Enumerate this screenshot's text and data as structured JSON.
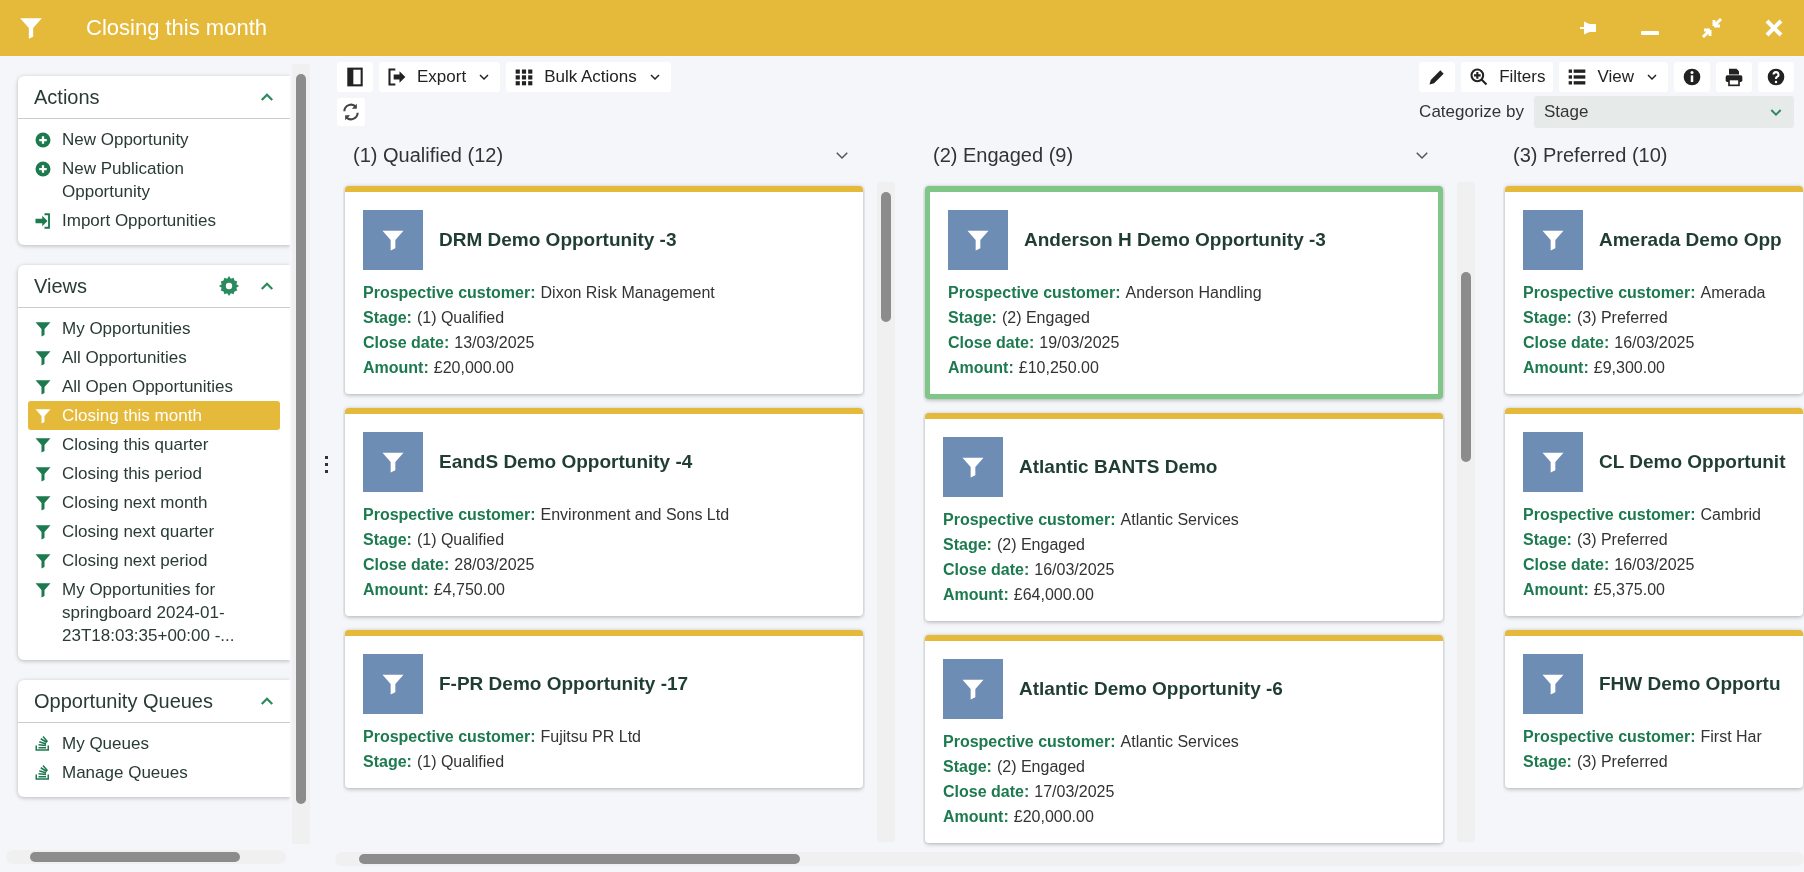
{
  "window": {
    "title": "Closing this month"
  },
  "sidebar": {
    "sections": [
      {
        "title": "Actions",
        "expanded": true,
        "settings": false,
        "items": [
          {
            "label": "New Opportunity",
            "kind": "plus"
          },
          {
            "label": "New Publication Opportunity",
            "kind": "plus"
          },
          {
            "label": "Import Opportunities",
            "kind": "import"
          }
        ]
      },
      {
        "title": "Views",
        "expanded": true,
        "settings": true,
        "items": [
          {
            "label": "My Opportunities",
            "kind": "filter",
            "selected": false
          },
          {
            "label": "All Opportunities",
            "kind": "filter",
            "selected": false
          },
          {
            "label": "All Open Opportunities",
            "kind": "filter",
            "selected": false
          },
          {
            "label": "Closing this month",
            "kind": "filter",
            "selected": true
          },
          {
            "label": "Closing this quarter",
            "kind": "filter",
            "selected": false
          },
          {
            "label": "Closing this period",
            "kind": "filter",
            "selected": false
          },
          {
            "label": "Closing next month",
            "kind": "filter",
            "selected": false
          },
          {
            "label": "Closing next quarter",
            "kind": "filter",
            "selected": false
          },
          {
            "label": "Closing next period",
            "kind": "filter",
            "selected": false
          },
          {
            "label": "My Opportunities for springboard 2024-01-23T18:03:35+00:00 -...",
            "kind": "filter",
            "selected": false
          }
        ]
      },
      {
        "title": "Opportunity Queues",
        "expanded": true,
        "settings": false,
        "items": [
          {
            "label": "My Queues",
            "kind": "queue"
          },
          {
            "label": "Manage Queues",
            "kind": "queue"
          }
        ]
      }
    ]
  },
  "toolbar": {
    "left": [
      {
        "kind": "panel"
      },
      {
        "kind": "export",
        "label": "Export",
        "dropdown": true
      },
      {
        "kind": "grid",
        "label": "Bulk Actions",
        "dropdown": true
      }
    ],
    "right": [
      {
        "kind": "pencil"
      },
      {
        "kind": "zoom",
        "label": "Filters"
      },
      {
        "kind": "list",
        "label": "View",
        "dropdown": true
      },
      {
        "kind": "info"
      },
      {
        "kind": "print"
      },
      {
        "kind": "help"
      }
    ]
  },
  "categorize": {
    "label": "Categorize by",
    "value": "Stage"
  },
  "columns": [
    {
      "title": "(1) Qualified (12)",
      "toggle": true,
      "cards": [
        {
          "title": "DRM Demo Opportunity -3",
          "highlighted": false,
          "fields": [
            {
              "label": "Prospective customer:",
              "value": "Dixon Risk Management"
            },
            {
              "label": "Stage:",
              "value": "(1) Qualified"
            },
            {
              "label": "Close date:",
              "value": "13/03/2025"
            },
            {
              "label": "Amount:",
              "value": "£20,000.00"
            }
          ]
        },
        {
          "title": "EandS Demo Opportunity -4",
          "highlighted": false,
          "fields": [
            {
              "label": "Prospective customer:",
              "value": "Environment and Sons Ltd"
            },
            {
              "label": "Stage:",
              "value": "(1) Qualified"
            },
            {
              "label": "Close date:",
              "value": "28/03/2025"
            },
            {
              "label": "Amount:",
              "value": "£4,750.00"
            }
          ]
        },
        {
          "title": "F-PR Demo Opportunity -17",
          "highlighted": false,
          "fields": [
            {
              "label": "Prospective customer:",
              "value": "Fujitsu PR Ltd"
            },
            {
              "label": "Stage:",
              "value": "(1) Qualified"
            }
          ]
        }
      ]
    },
    {
      "title": "(2) Engaged (9)",
      "toggle": true,
      "cards": [
        {
          "title": "Anderson H Demo Opportunity -3",
          "highlighted": true,
          "fields": [
            {
              "label": "Prospective customer:",
              "value": "Anderson Handling"
            },
            {
              "label": "Stage:",
              "value": "(2) Engaged"
            },
            {
              "label": "Close date:",
              "value": "19/03/2025"
            },
            {
              "label": "Amount:",
              "value": "£10,250.00"
            }
          ]
        },
        {
          "title": "Atlantic BANTS Demo",
          "highlighted": false,
          "fields": [
            {
              "label": "Prospective customer:",
              "value": "Atlantic Services"
            },
            {
              "label": "Stage:",
              "value": "(2) Engaged"
            },
            {
              "label": "Close date:",
              "value": "16/03/2025"
            },
            {
              "label": "Amount:",
              "value": "£64,000.00"
            }
          ]
        },
        {
          "title": "Atlantic Demo Opportunity -6",
          "highlighted": false,
          "fields": [
            {
              "label": "Prospective customer:",
              "value": "Atlantic Services"
            },
            {
              "label": "Stage:",
              "value": "(2) Engaged"
            },
            {
              "label": "Close date:",
              "value": "17/03/2025"
            },
            {
              "label": "Amount:",
              "value": "£20,000.00"
            }
          ]
        }
      ]
    },
    {
      "title": "(3) Preferred (10)",
      "toggle": false,
      "cards": [
        {
          "title": "Amerada Demo Opp",
          "highlighted": false,
          "fields": [
            {
              "label": "Prospective customer:",
              "value": "Amerada"
            },
            {
              "label": "Stage:",
              "value": "(3) Preferred"
            },
            {
              "label": "Close date:",
              "value": "16/03/2025"
            },
            {
              "label": "Amount:",
              "value": "£9,300.00"
            }
          ]
        },
        {
          "title": "CL Demo Opportunit",
          "highlighted": false,
          "fields": [
            {
              "label": "Prospective customer:",
              "value": "Cambrid"
            },
            {
              "label": "Stage:",
              "value": "(3) Preferred"
            },
            {
              "label": "Close date:",
              "value": "16/03/2025"
            },
            {
              "label": "Amount:",
              "value": "£5,375.00"
            }
          ]
        },
        {
          "title": "FHW Demo Opportu",
          "highlighted": false,
          "fields": [
            {
              "label": "Prospective customer:",
              "value": "First Har"
            },
            {
              "label": "Stage:",
              "value": "(3) Preferred"
            }
          ]
        }
      ]
    }
  ]
}
